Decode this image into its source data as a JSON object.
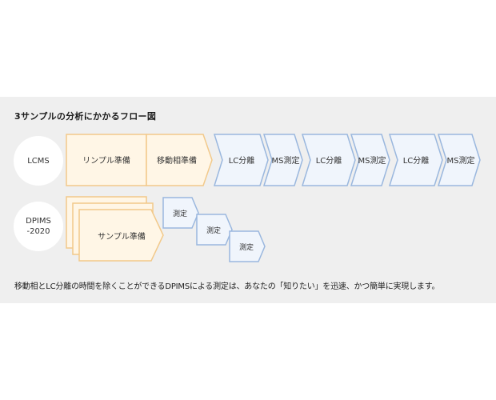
{
  "title": "3サンプルの分析にかかるフロー図",
  "rows": {
    "lcms": {
      "label": "LCMS",
      "steps": [
        "リンプル準備",
        "移動相準備",
        "LC分離",
        "MS測定",
        "LC分離",
        "MS測定",
        "LC分離",
        "MS測定"
      ]
    },
    "dpims": {
      "label": "DPIMS\n-2020",
      "prep": "サンプル準備",
      "measure": [
        "測定",
        "測定",
        "測定"
      ]
    }
  },
  "caption": "移動相とLC分離の時間を除くことができるDPIMSによる測定は、あなたの「知りたい」を迅速、かつ簡単に実現します。",
  "colors": {
    "orange_border": "#f2c98a",
    "orange_fill": "#fff6e6",
    "blue_border": "#9ab7de",
    "blue_fill": "#f0f5fc",
    "panel": "#efefef"
  }
}
